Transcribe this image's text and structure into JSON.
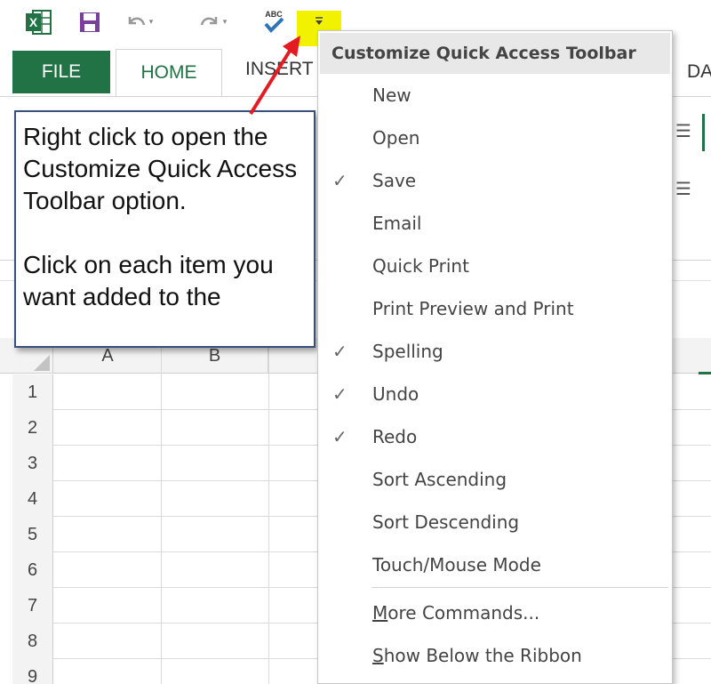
{
  "quick_access": {
    "excel_logo_icon": "excel-logo-icon",
    "save_icon": "floppy-disk-icon",
    "undo_icon": "undo-icon",
    "redo_icon": "redo-icon",
    "spelling_icon": "spelling-check-icon",
    "spelling_abc": "ABC",
    "dropdown_icon": "customize-dropdown-icon",
    "highlight_color": "#f2f200"
  },
  "ribbon": {
    "tab_file": "FILE",
    "tab_home": "HOME",
    "tab_insert": "INSERT",
    "tab_data_partial": "DA",
    "accent_color": "#217346"
  },
  "callout": {
    "paragraph1": "Right click to open the Customize Quick Access Toolbar option.",
    "paragraph2": "Click on each item you want added to the"
  },
  "menu": {
    "title": "Customize Quick Access Toolbar",
    "items": [
      {
        "label": "New",
        "checked": false
      },
      {
        "label": "Open",
        "checked": false
      },
      {
        "label": "Save",
        "checked": true
      },
      {
        "label": "Email",
        "checked": false
      },
      {
        "label": "Quick Print",
        "checked": false
      },
      {
        "label": "Print Preview and Print",
        "checked": false
      },
      {
        "label": "Spelling",
        "checked": true
      },
      {
        "label": "Undo",
        "checked": true
      },
      {
        "label": "Redo",
        "checked": true
      },
      {
        "label": "Sort Ascending",
        "checked": false
      },
      {
        "label": "Sort Descending",
        "checked": false
      },
      {
        "label": "Touch/Mouse Mode",
        "checked": false
      }
    ],
    "more_commands": {
      "mnemonic": "M",
      "rest": "ore Commands..."
    },
    "show_below": {
      "mnemonic": "S",
      "rest": "how Below the Ribbon"
    },
    "check_glyph": "✓"
  },
  "sheet": {
    "columns": [
      "A",
      "B"
    ],
    "rows": [
      "1",
      "2",
      "3",
      "4",
      "5",
      "6",
      "7",
      "8",
      "9"
    ]
  }
}
